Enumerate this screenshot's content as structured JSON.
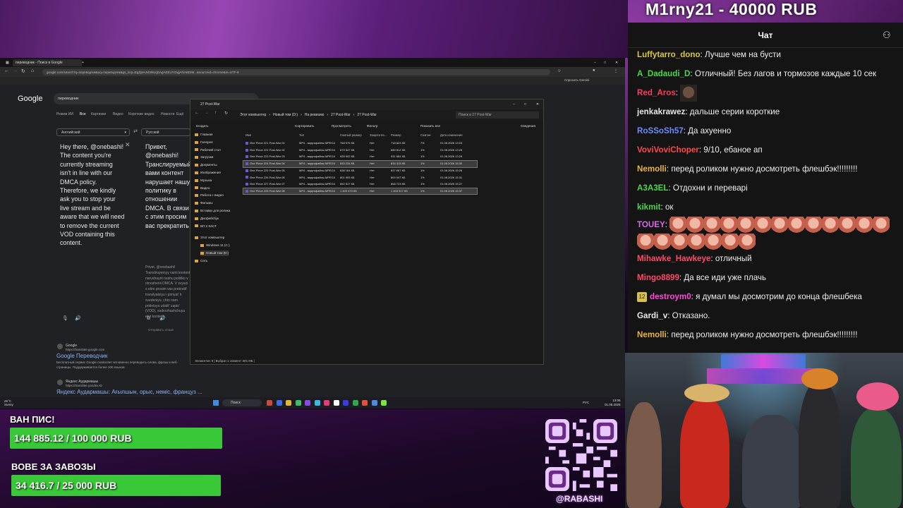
{
  "donation_alert": {
    "name": "M1rny21",
    "amount": "40000 RUB",
    "text": "M1rny21 - 40000 RUB"
  },
  "browser": {
    "tabs": [
      "переводчик - Поиск в Google"
    ],
    "address": "google.com/search?q=переводчик&oq=переводчик&gs_lcrp=EgZjaHJvbWUqDAgAEEUYOxjjAhiABDIM...&sourceid=chrome&ie=UTF-8",
    "bookmarks": [
      "ChatGPT",
      "Вставить лучший...",
      "Смотреть аниме...",
      "Онлайн-аниме...",
      "Rabashi - анали...",
      "Мессенджер",
      "Почтовый ящик",
      "MailRu: почта, н...",
      "YouTube",
      "Почта управлен...",
      "Rabashi - YouTube",
      "Каталог книги. Чит...",
      "Почта управлен...",
      "rabashi - Donation A...",
      "YOtrade.com",
      "PayPal Settings",
      "Смотреть аниме в..."
    ],
    "bookmark_right": "Спросить Gemini"
  },
  "google": {
    "logo": "Google",
    "query": "переводчик",
    "nav": [
      "Режим ИИ",
      "Все",
      "Картинки",
      "Видео",
      "Короткие видео",
      "Новости",
      "Ещё"
    ],
    "source_lang": "Английский",
    "target_lang": "Русский",
    "source_text": "Hey there, @onebashi! The content you're currently streaming isn't in line with our DMCA policy. Therefore, we kindly ask you to stop your live stream and be aware that we will need to remove the current VOD containing this content.",
    "target_text": "Привет, @onebashi! Транслируемый вами контент нарушает нашу политику в отношении DMCA. В связи с этим просим вас прекратить трансляцию и принять к сведению, что нам придется удалить запись (VOD), содержащую этот контент.",
    "translit": "Privet, @onebashi! Transliruyemyy vami kontent narushayet nashu politiku v otnoshenii DMCA. V svyazi s etim prosim vas prekratit' translyatsiyu i prinyat' k svedeniyu, chto nam pridetsya udalit' zapis' (VOD), soderzhashchuyu etot kontent.",
    "feedback": "Отправить отзыв",
    "result1": {
      "site": "Google",
      "url": "https://translate.google.com",
      "title": "Google Переводчик",
      "desc": "Бесплатный сервис Google позволяет мгновенно переводить слова, фразы и веб-страницы. Поддерживается более 100 языков."
    },
    "result2": {
      "site": "Яндекс Аудармашы",
      "url": "https://translate.yandex.kz",
      "title": "Яндекс Аудармашы: Ағылшын, орыс, неміс, француз ..."
    }
  },
  "explorer": {
    "title": "27 Post-War",
    "breadcrumb": [
      "Этот компьютер",
      "Новый том (D:)",
      "На ревизию",
      "27 Post-War",
      "27 Post-War"
    ],
    "search_placeholder": "Поиск в 27 Post-War",
    "toolbar": [
      "Создать",
      "Сортировать",
      "Просмотреть",
      "Фильтр",
      "Показать все",
      "Сведения"
    ],
    "nav": [
      "Главная",
      "Галерея",
      "Рабочий стол",
      "Загрузки",
      "Документы",
      "Изображения",
      "Музыка",
      "Видео",
      "Работа с видео",
      "Фильмы",
      "Вставки для ролика",
      "Дисфейсбук",
      "ВП 2 КАСТ",
      "Этот компьютер",
      "Windows 11 (C:)",
      "Новый том (D:)",
      "Сеть"
    ],
    "columns": [
      "Имя",
      "Тип",
      "Сжатый размер",
      "Защита па...",
      "Размер",
      "Сжатие",
      "Дата изменения"
    ],
    "files": [
      {
        "name": "One Piece 221 Post-War 01",
        "type": "MP4 - видеофайлы MPEG4",
        "csize": "768 576 КБ",
        "prot": "Нет",
        "size": "718 623 КБ",
        "ratio": "7%",
        "date": "01.08.2026 13:03",
        "sel": false
      },
      {
        "name": "One Piece 222 Post-War 02",
        "type": "MP4 - видеофайлы MPEG4",
        "csize": "879 547 КБ",
        "prot": "Нет",
        "size": "880 812 КБ",
        "ratio": "1%",
        "date": "01.08.2026 13:28",
        "sel": false
      },
      {
        "name": "One Piece 223 Post-War 03",
        "type": "MP4 - видеофайлы MPEG4",
        "csize": "928 902 КБ",
        "prot": "Нет",
        "size": "931 684 КБ",
        "ratio": "1%",
        "date": "01.08.2026 13:29",
        "sel": false
      },
      {
        "name": "One Piece 224 Post-War 04",
        "type": "MP4 - видеофайлы MPEG4",
        "csize": "833 234 КБ",
        "prot": "Нет",
        "size": "834 313 КБ",
        "ratio": "1%",
        "date": "01.08.2026 15:30",
        "sel": true
      },
      {
        "name": "One Piece 225 Post-War 05",
        "type": "MP4 - видеофайлы MPEG4",
        "csize": "838 184 КБ",
        "prot": "Нет",
        "size": "837 667 КБ",
        "ratio": "1%",
        "date": "01.08.2026 15:26",
        "sel": false
      },
      {
        "name": "One Piece 226 Post-War 06",
        "type": "MP4 - видеофайлы MPEG4",
        "csize": "801 993 КБ",
        "prot": "Нет",
        "size": "800 047 КБ",
        "ratio": "1%",
        "date": "01.08.2026 15:31",
        "sel": false
      },
      {
        "name": "One Piece 227 Post-War 07",
        "type": "MP4 - видеофайлы MPEG4",
        "csize": "852 517 КБ",
        "prot": "Нет",
        "size": "858 723 КБ",
        "ratio": "1%",
        "date": "01.08.2026 15:27",
        "sel": false
      },
      {
        "name": "One Piece 228 Post-War 08",
        "type": "MP4 - видеофайлы MPEG4",
        "csize": "1 400 470 КБ",
        "prot": "Нет",
        "size": "1 403 917 КБ",
        "ratio": "1%",
        "date": "01.08.2026 15:37",
        "sel": true
      }
    ],
    "status": "Элементов: 8  |  Выбран 1 элемент: 801 МБ  |"
  },
  "taskbar": {
    "weather_temp": "26°C",
    "weather_desc": "Sunny",
    "search": "Поиск",
    "lang": "РУС",
    "time": "13:06",
    "date": "01.08.2026"
  },
  "goals": [
    {
      "label": "ВАН ПИС!",
      "text": "144 885.12 / 100 000 RUB",
      "fraction": 1.0
    },
    {
      "label": "ВОВЕ ЗА ЗАВОЗЫ",
      "text": "34 416.7 / 25 000 RUB",
      "fraction": 1.0
    }
  ],
  "handle": "@RABASHI",
  "chat": {
    "title": "Чат",
    "messages": [
      {
        "user": "Luffytarro_dono",
        "color": "#d4c83c",
        "text": "Лучше чем на бусти"
      },
      {
        "user": "A_Dadaudi_D",
        "color": "#4ad84a",
        "text": "Отличный! Без лагов и тормозов каждые 10 сек"
      },
      {
        "user": "Red_Aros",
        "color": "#ff3c5a",
        "text": ""
      },
      {
        "user": "jenkakrawez",
        "color": "#e8e8e8",
        "text": "дальше серии короткие"
      },
      {
        "user": "RoSSoSh57",
        "color": "#6c8cff",
        "text": "Да ахуенно"
      },
      {
        "user": "VoviVoviChoper",
        "color": "#ff4a4a",
        "text": "9/10, ебаное ап"
      },
      {
        "user": "Nemolli",
        "color": "#e8b43a",
        "text": "перед роликом нужно досмотреть флешбэк!!!!!!!!!"
      },
      {
        "user": "A3A3EL",
        "color": "#4ad84a",
        "text": "Отдохни и переварi"
      },
      {
        "user": "kikmit",
        "color": "#4ad84a",
        "text": "ок"
      },
      {
        "user": "TOUEY",
        "color": "#d86ae8",
        "text": ""
      },
      {
        "user": "Mihawke_Hawkeye",
        "color": "#ff4a6a",
        "text": "отличный"
      },
      {
        "user": "Mingo8899",
        "color": "#ff4a6a",
        "text": "Да все иди уже плачь"
      },
      {
        "user": "destroym0",
        "color": "#ff4ad8",
        "text": "я думал мы досмотрим до конца флешбека",
        "badge": "12"
      },
      {
        "user": "Gardi_v",
        "color": "#e8e8e8",
        "text": "Отказано."
      },
      {
        "user": "Nemolli",
        "color": "#e8b43a",
        "text": "перед роликом нужно досмотреть флешбэк!!!!!!!!!"
      }
    ]
  }
}
